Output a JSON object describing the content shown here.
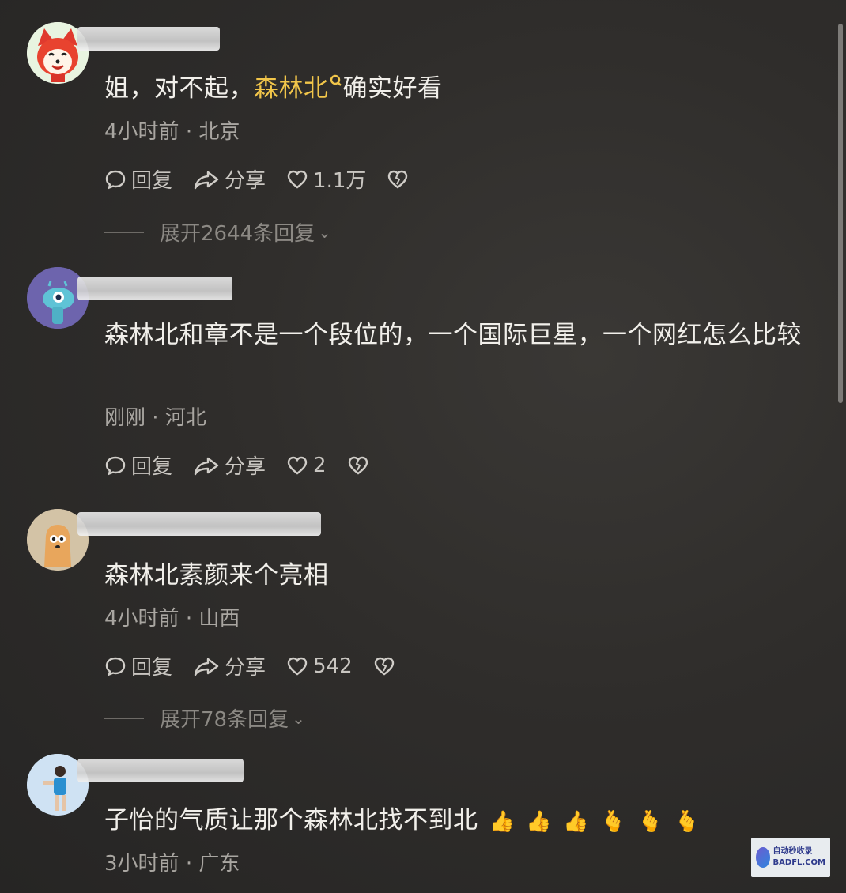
{
  "comments": [
    {
      "text_before": "姐，对不起，",
      "highlight": "森林北",
      "text_after": "确实好看",
      "time": "4小时前",
      "location": "北京",
      "reply_label": "回复",
      "share_label": "分享",
      "likes": "1.1万",
      "expand_label": "展开2644条回复"
    },
    {
      "text": "森林北和章不是一个段位的，一个国际巨星，一个网红怎么比较",
      "time": "刚刚",
      "location": "河北",
      "reply_label": "回复",
      "share_label": "分享",
      "likes": "2"
    },
    {
      "text": "森林北素颜来个亮相",
      "time": "4小时前",
      "location": "山西",
      "reply_label": "回复",
      "share_label": "分享",
      "likes": "542",
      "expand_label": "展开78条回复"
    },
    {
      "text": "子怡的气质让那个森林北找不到北",
      "emojis": [
        "👍",
        "👍",
        "👍",
        "🫰",
        "🫰",
        "🫰"
      ],
      "time": "3小时前",
      "location": "广东"
    }
  ],
  "meta_separator": "·",
  "watermark": {
    "line1": "自动秒收录",
    "line2": "BADFL.COM"
  },
  "colors": {
    "background": "#2f2d2b",
    "highlight": "#f2c64a",
    "meta": "#a9a6a1"
  }
}
